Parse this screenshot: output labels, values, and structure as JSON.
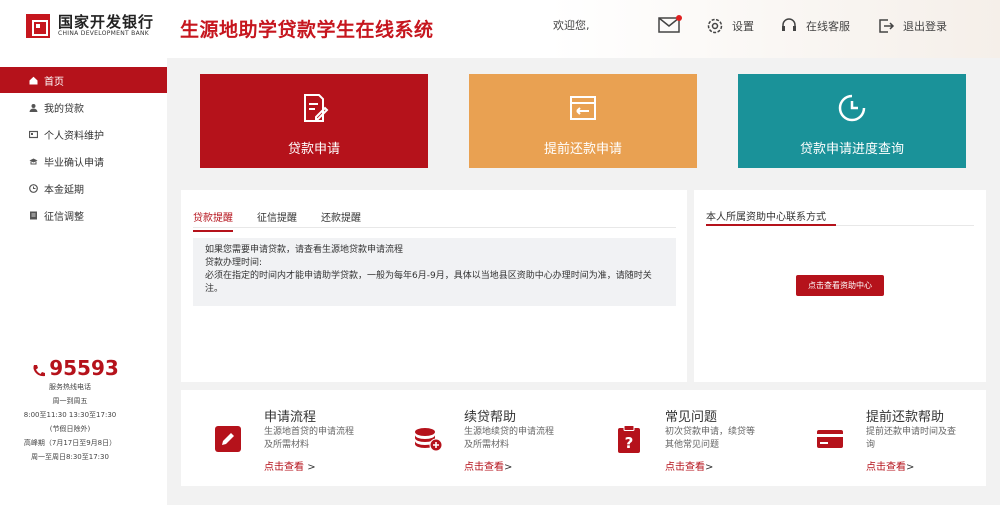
{
  "header": {
    "logo_cn": "国家开发银行",
    "logo_en": "CHINA DEVELOPMENT BANK",
    "system_title": "生源地助学贷款学生在线系统",
    "welcome": "欢迎您,",
    "settings_label": "设置",
    "service_label": "在线客服",
    "logout_label": "退出登录"
  },
  "sidebar": {
    "items": [
      {
        "label": "首页",
        "icon": "home-icon"
      },
      {
        "label": "我的贷款",
        "icon": "user-icon"
      },
      {
        "label": "个人资料维护",
        "icon": "id-card-icon"
      },
      {
        "label": "毕业确认申请",
        "icon": "graduation-icon"
      },
      {
        "label": "本金延期",
        "icon": "clock-icon"
      },
      {
        "label": "征信调整",
        "icon": "document-icon"
      }
    ],
    "active_index": 0,
    "hotline": {
      "number": "95593",
      "lines": [
        "服务热线电话",
        "周一到周五",
        "8:00至11:30 13:30至17:30",
        "(节假日除外)",
        "高峰期（7月17日至9月8日）",
        "周一至周日8:30至17:30"
      ]
    }
  },
  "tiles": [
    {
      "label": "贷款申请",
      "icon": "edit-document-icon",
      "color": "#b5121b"
    },
    {
      "label": "提前还款申请",
      "icon": "return-icon",
      "color": "#e9a152"
    },
    {
      "label": "贷款申请进度查询",
      "icon": "progress-clock-icon",
      "color": "#1a9299"
    }
  ],
  "notice_panel": {
    "tabs": [
      "贷款提醒",
      "征信提醒",
      "还款提醒"
    ],
    "active_tab": 0,
    "lines": [
      "如果您需要申请贷款，请查看生源地贷款申请流程",
      "贷款办理时间:",
      "必须在指定的时间内才能申请助学贷款，一般为每年6月-9月，具体以当地县区资助中心办理时间为准，请随时关注。"
    ]
  },
  "contact_panel": {
    "title": "本人所属资助中心联系方式",
    "button_label": "点击查看资助中心"
  },
  "help": [
    {
      "title": "申请流程",
      "desc": "生源地首贷的申请流程及所需材料",
      "link": "点击查看",
      "arrow": ">",
      "icon": "pencil-icon"
    },
    {
      "title": "续贷帮助",
      "desc": "生源地续贷的申请流程及所需材料",
      "link": "点击查看",
      "arrow": ">",
      "icon": "coins-plus-icon"
    },
    {
      "title": "常见问题",
      "desc": "初次贷款申请，续贷等其他常见问题",
      "link": "点击查看",
      "arrow": ">",
      "icon": "question-clipboard-icon"
    },
    {
      "title": "提前还款帮助",
      "desc": "提前还款申请时间及查询",
      "link": "点击查看",
      "arrow": ">",
      "icon": "bank-card-icon"
    }
  ],
  "colors": {
    "brand_red": "#b5121b",
    "orange": "#e9a152",
    "teal": "#1a9299"
  }
}
